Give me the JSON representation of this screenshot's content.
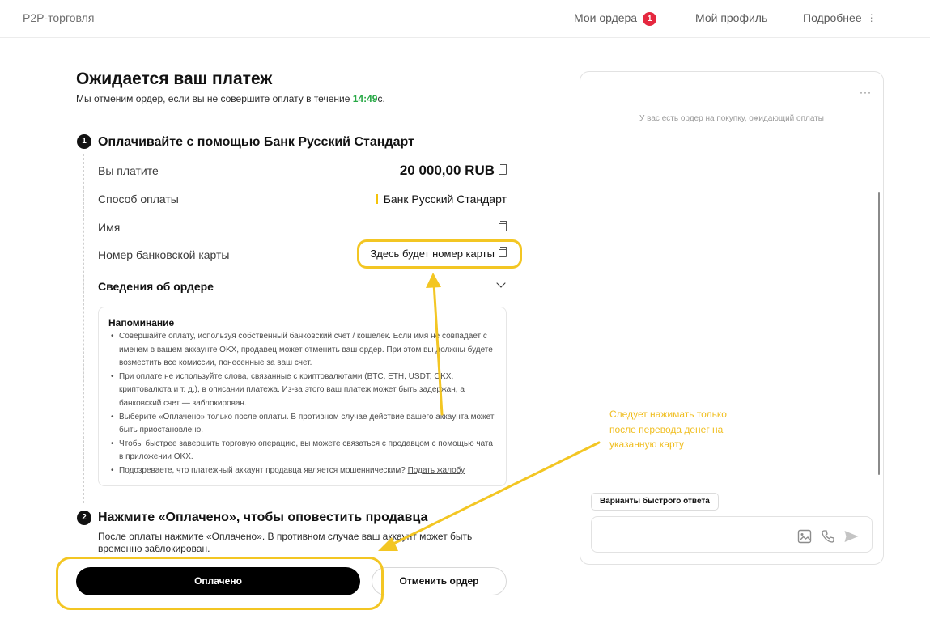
{
  "header": {
    "brand": "P2P-торговля",
    "orders_label": "Мои ордера",
    "orders_badge": "1",
    "profile_label": "Мой профиль",
    "more_label": "Подробнее",
    "more_icon": "⋮"
  },
  "main": {
    "title": "Ожидается ваш платеж",
    "subtitle_prefix": "Мы отменим ордер, если вы не совершите оплату в течение ",
    "timer": "14:49",
    "subtitle_suffix": "с.",
    "step1": {
      "number": "1",
      "title": "Оплачивайте с помощью Банк Русский Стандарт",
      "rows": {
        "pay_label": "Вы платите",
        "pay_value": "20 000,00 RUB",
        "method_label": "Способ оплаты",
        "method_value": "Банк Русский Стандарт",
        "name_label": "Имя",
        "card_label": "Номер банковской карты",
        "card_value": "Здесь будет номер карты"
      },
      "details_label": "Сведения об ордере",
      "reminder": {
        "title": "Напоминание",
        "items": [
          "Совершайте оплату, используя собственный банковский счет / кошелек. Если имя не совпадает с именем в вашем аккаунте OKX, продавец может отменить ваш ордер. При этом вы должны будете возместить все комиссии, понесенные за ваш счет.",
          "При оплате не используйте слова, связанные с криптовалютами (BTC, ETH, USDT, OKX, криптовалюта и т. д.), в описании платежа. Из-за этого ваш платеж может быть задержан, а банковский счет — заблокирован.",
          "Выберите «Оплачено» только после оплаты. В противном случае действие вашего аккаунта может быть приостановлено.",
          "Чтобы быстрее завершить торговую операцию, вы можете связаться с продавцом с помощью чата в приложении OKX."
        ],
        "last_item_text": "Подозреваете, что платежный аккаунт продавца является мошенническим? ",
        "last_item_link": "Подать жалобу"
      }
    },
    "step2": {
      "number": "2",
      "title": "Нажмите «Оплачено», чтобы оповестить продавца",
      "text": "После оплаты нажмите «Оплачено». В противном случае ваш аккаунт может быть временно заблокирован."
    },
    "paid_button": "Оплачено",
    "cancel_button": "Отменить ордер"
  },
  "chat": {
    "menu": "···",
    "info": "У вас есть ордер на покупку, ожидающий оплаты",
    "quick_replies": "Варианты быстрого ответа",
    "input_value": ""
  },
  "annotation": {
    "text": "Следует нажимать только после перевода денег на указанную карту"
  },
  "colors": {
    "accent_yellow": "#f3c623",
    "timer_green": "#27a845",
    "badge_red": "#e5283f",
    "button_black": "#000000"
  }
}
